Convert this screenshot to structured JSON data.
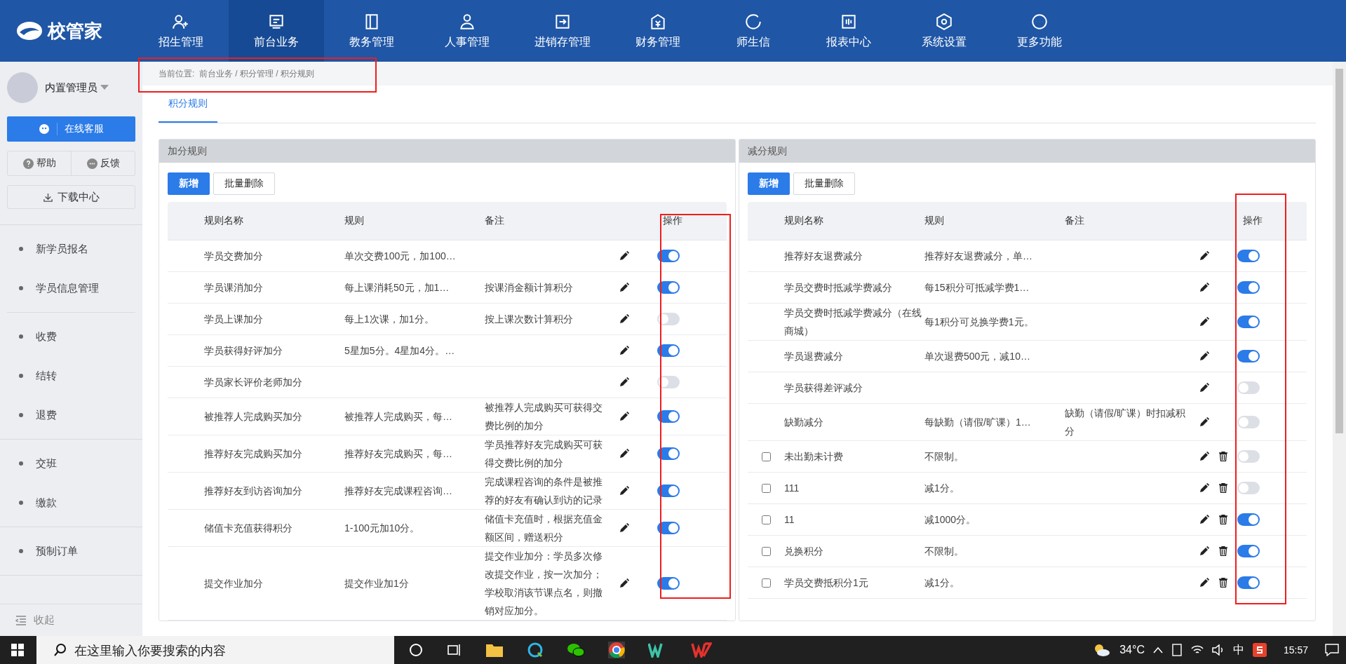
{
  "app": {
    "logo_text": "校管家"
  },
  "nav": [
    {
      "label": "招生管理",
      "selected": false
    },
    {
      "label": "前台业务",
      "selected": true
    },
    {
      "label": "教务管理",
      "selected": false
    },
    {
      "label": "人事管理",
      "selected": false
    },
    {
      "label": "进销存管理",
      "selected": false
    },
    {
      "label": "财务管理",
      "selected": false
    },
    {
      "label": "师生信",
      "selected": false
    },
    {
      "label": "报表中心",
      "selected": false
    },
    {
      "label": "系统设置",
      "selected": false
    },
    {
      "label": "更多功能",
      "selected": false
    }
  ],
  "sidebar": {
    "user": "内置管理员",
    "service_button": "在线客服",
    "help_button": "帮助",
    "feedback_button": "反馈",
    "download_button": "下载中心",
    "groups": [
      {
        "items": [
          "新学员报名",
          "学员信息管理"
        ]
      },
      {
        "items": [
          "收费",
          "结转",
          "退费"
        ]
      },
      {
        "items": [
          "交班",
          "缴款"
        ]
      },
      {
        "items": [
          "预制订单"
        ]
      }
    ],
    "collapse": "收起"
  },
  "breadcrumb": {
    "label": "当前位置:",
    "path": "前台业务 / 积分管理 / 积分规则"
  },
  "tabs": [
    {
      "label": "积分规则",
      "selected": true
    }
  ],
  "panels": [
    {
      "title": "加分规则",
      "add_button": "新增",
      "delete_button": "批量删除",
      "columns": [
        "规则名称",
        "规则",
        "备注",
        "操作"
      ],
      "rows": [
        {
          "kind": "system",
          "name": "学员交费加分",
          "rule": "单次交费100元，加100…",
          "note": "",
          "enabled": true
        },
        {
          "kind": "system",
          "name": "学员课消加分",
          "rule": "每上课消耗50元，加1…",
          "note": "按课消金额计算积分",
          "enabled": true
        },
        {
          "kind": "system",
          "name": "学员上课加分",
          "rule": "每上1次课，加1分。",
          "note": "按上课次数计算积分",
          "enabled": false
        },
        {
          "kind": "system",
          "name": "学员获得好评加分",
          "rule": "5星加5分。4星加4分。…",
          "note": "",
          "enabled": true
        },
        {
          "kind": "system",
          "name": "学员家长评价老师加分",
          "rule": "",
          "note": "",
          "enabled": false
        },
        {
          "kind": "system",
          "name": "被推荐人完成购买加分",
          "rule": "被推荐人完成购买，每…",
          "note": "被推荐人完成购买可获得交费比例的加分",
          "enabled": true
        },
        {
          "kind": "system",
          "name": "推荐好友完成购买加分",
          "rule": "推荐好友完成购买，每…",
          "note": "学员推荐好友完成购买可获得交费比例的加分",
          "enabled": true
        },
        {
          "kind": "system",
          "name": "推荐好友到访咨询加分",
          "rule": "推荐好友完成课程咨询…",
          "note": "完成课程咨询的条件是被推荐的好友有确认到访的记录",
          "enabled": true
        },
        {
          "kind": "system",
          "name": "储值卡充值获得积分",
          "rule": "1-100元加10分。",
          "note": "储值卡充值时，根据充值金额区间，赠送积分",
          "enabled": true
        },
        {
          "kind": "system",
          "name": "提交作业加分",
          "rule": "提交作业加1分",
          "note": "提交作业加分：学员多次修改提交作业，按一次加分；学校取消该节课点名，则撤销对应加分。",
          "enabled": true
        }
      ]
    },
    {
      "title": "减分规则",
      "add_button": "新增",
      "delete_button": "批量删除",
      "columns": [
        "规则名称",
        "规则",
        "备注",
        "操作"
      ],
      "rows": [
        {
          "kind": "system",
          "name": "推荐好友退费减分",
          "rule": "推荐好友退费减分，单…",
          "note": "",
          "enabled": true
        },
        {
          "kind": "system",
          "name": "学员交费时抵减学费减分",
          "rule": "每15积分可抵减学费1…",
          "note": "",
          "enabled": true
        },
        {
          "kind": "system",
          "name": "学员交费时抵减学费减分（在线商城）",
          "rule": "每1积分可兑换学费1元。",
          "note": "",
          "enabled": true
        },
        {
          "kind": "system",
          "name": "学员退费减分",
          "rule": "单次退费500元，减10…",
          "note": "",
          "enabled": true
        },
        {
          "kind": "system",
          "name": "学员获得差评减分",
          "rule": "",
          "note": "",
          "enabled": false
        },
        {
          "kind": "system",
          "name": "缺勤减分",
          "rule": "每缺勤（请假/旷课）1…",
          "note": "缺勤（请假/旷课）时扣减积分",
          "enabled": false
        },
        {
          "kind": "custom",
          "name": "未出勤未计费",
          "rule": "不限制。",
          "note": "",
          "enabled": false,
          "checked": false
        },
        {
          "kind": "custom",
          "name": "111",
          "rule": "减1分。",
          "note": "",
          "enabled": false,
          "checked": false
        },
        {
          "kind": "custom",
          "name": "11",
          "rule": "减1000分。",
          "note": "",
          "enabled": true,
          "checked": false
        },
        {
          "kind": "custom",
          "name": "兑换积分",
          "rule": "不限制。",
          "note": "",
          "enabled": true,
          "checked": false
        },
        {
          "kind": "custom",
          "name": "学员交费抵积分1元",
          "rule": "减1分。",
          "note": "",
          "enabled": true,
          "checked": false
        }
      ]
    }
  ],
  "taskbar": {
    "search_placeholder": "在这里输入你要搜索的内容",
    "weather": "34°C",
    "ime": "中",
    "time": "15:57"
  }
}
